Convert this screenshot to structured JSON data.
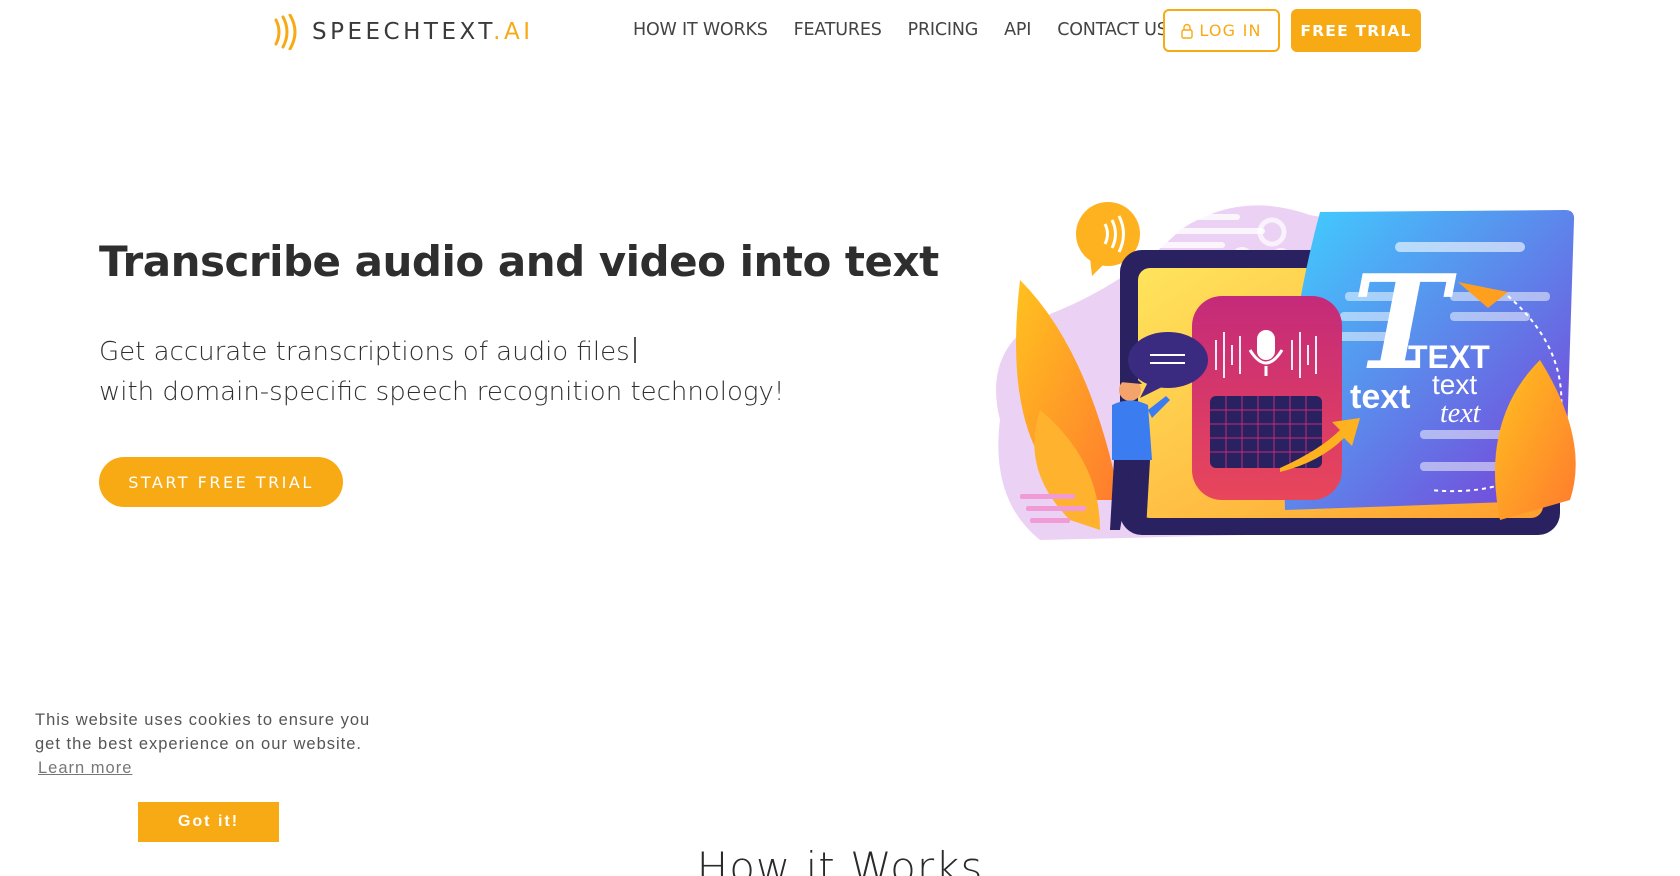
{
  "header": {
    "logo_text": "SPEECHTEXT",
    "logo_suffix": ".AI",
    "nav": [
      "HOW IT WORKS",
      "FEATURES",
      "PRICING",
      "API",
      "CONTACT US"
    ],
    "login_label": "LOG IN",
    "trial_label": "FREE TRIAL"
  },
  "hero": {
    "title": "Transcribe audio and video into text",
    "subtitle_line1": "Get accurate transcriptions of audio files",
    "subtitle_line2": "with domain-specific speech recognition technology!",
    "cta_label": "START FREE TRIAL"
  },
  "illustration": {
    "big_letter": "T",
    "word_caps": "TEXT",
    "word_bold": "text",
    "word_plain": "text",
    "word_italic": "text"
  },
  "cookie": {
    "message": "This website uses cookies to ensure you get the best experience on our website.",
    "learn_more": "Learn more",
    "accept_label": "Got it!"
  },
  "section": {
    "title": "How it Works"
  },
  "colors": {
    "accent": "#f8aa14",
    "text_dark": "#2e2e2e"
  }
}
